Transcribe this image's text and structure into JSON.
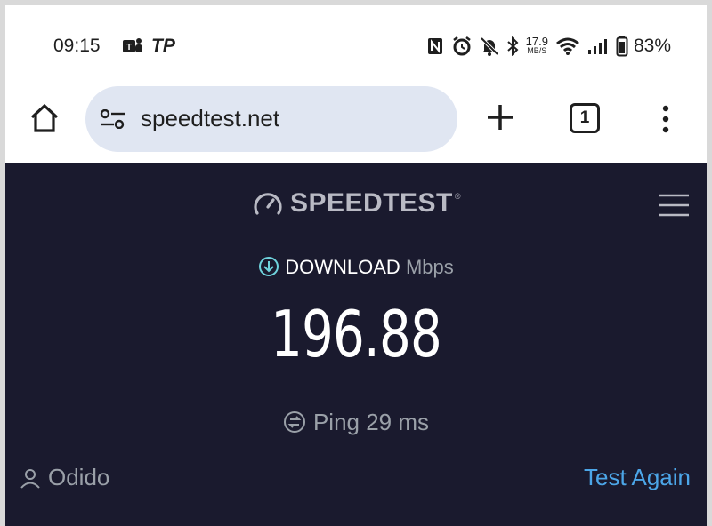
{
  "status_bar": {
    "time": "09:15",
    "app_icons": [
      "teams-icon",
      "tp-icon"
    ],
    "tp_label": "TP",
    "net_speed_value": "17.9",
    "net_speed_unit": "MB/S",
    "battery": "83%"
  },
  "browser": {
    "url": "speedtest.net",
    "tab_count": "1"
  },
  "speedtest": {
    "logo_text": "SPEEDTEST",
    "logo_tm": "®",
    "download_label": "DOWNLOAD",
    "download_unit": "Mbps",
    "download_value": "196.88",
    "ping_label": "Ping 29 ms",
    "isp": "Odido",
    "test_again": "Test Again",
    "accent_color": "#4ca6e8",
    "background_color": "#1a1a2e"
  }
}
